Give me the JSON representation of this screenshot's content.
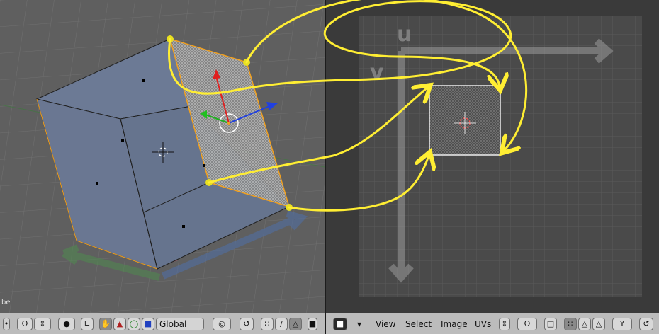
{
  "left_header": {
    "object_label_fragment": "be",
    "orientation_value": "Global"
  },
  "right_header": {
    "menu_view": "View",
    "menu_select": "Select",
    "menu_image": "Image",
    "menu_uvs": "UVs"
  },
  "uv_axes": {
    "u": "u",
    "v": "v"
  },
  "icons": [
    "pivot-icon",
    "mode-icon",
    "hand-icon",
    "triangle-icon",
    "circle-icon",
    "square-icon",
    "snap-icon",
    "vertex-select-icon",
    "edge-select-icon",
    "face-select-icon",
    "image-browse-icon",
    "dropdown-icon",
    "sync-icon",
    "sticky-icon",
    "view-icon",
    "link-icon"
  ],
  "colors": {
    "annotation": "#ffee33",
    "mesh_face": "#6f7d97",
    "mesh_edge": "#f0a020",
    "uv_grid": "#454545",
    "viewport_bg": "#5e5e5e"
  }
}
